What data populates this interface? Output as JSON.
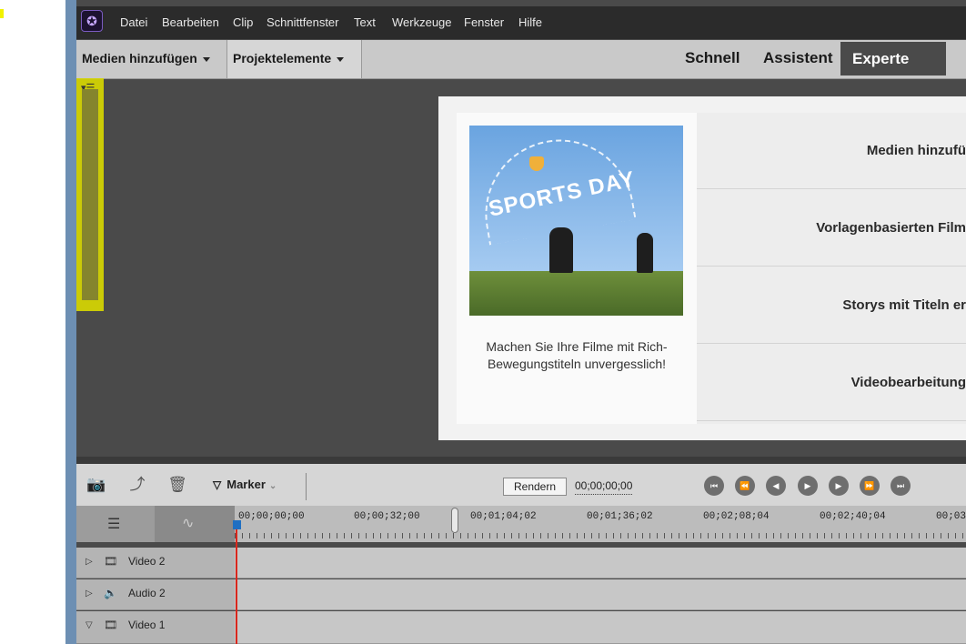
{
  "menubar": {
    "items": [
      "Datei",
      "Bearbeiten",
      "Clip",
      "Schnittfenster",
      "Text",
      "Werkzeuge",
      "Fenster",
      "Hilfe"
    ]
  },
  "toolbar": {
    "add_media": "Medien hinzufügen",
    "project_assets": "Projektelemente",
    "modes": [
      "Schnell",
      "Assistent",
      "Experte"
    ],
    "active_mode": "Experte"
  },
  "welcome_card": {
    "image_title": "SPORTS DAY",
    "caption": "Machen Sie Ihre Filme mit Rich-Bewegungstiteln unvergesslich!",
    "options": [
      "Medien hinzufü",
      "Vorlagenbasierten Film",
      "Storys mit Titeln er",
      "Videobearbeitung"
    ]
  },
  "timeline_toolbar": {
    "marker_label": "Marker",
    "render_label": "Rendern",
    "timecode": "00;00;00;00"
  },
  "ruler": {
    "labels": [
      "00;00;00;00",
      "00;00;32;00",
      "00;01;04;02",
      "00;01;36;02",
      "00;02;08;04",
      "00;02;40;04",
      "00;03;"
    ]
  },
  "tracks": [
    {
      "name": "Video 2",
      "type": "video",
      "expanded": false
    },
    {
      "name": "Audio 2",
      "type": "audio",
      "expanded": false
    },
    {
      "name": "Video 1",
      "type": "video",
      "expanded": true
    }
  ],
  "colors": {
    "menubar_bg": "#2b2b2b",
    "toolbar_bg": "#c9c9c9",
    "active_mode_bg": "#4a4a4a",
    "playhead": "#d9261c",
    "highlight": "#d9d900"
  }
}
